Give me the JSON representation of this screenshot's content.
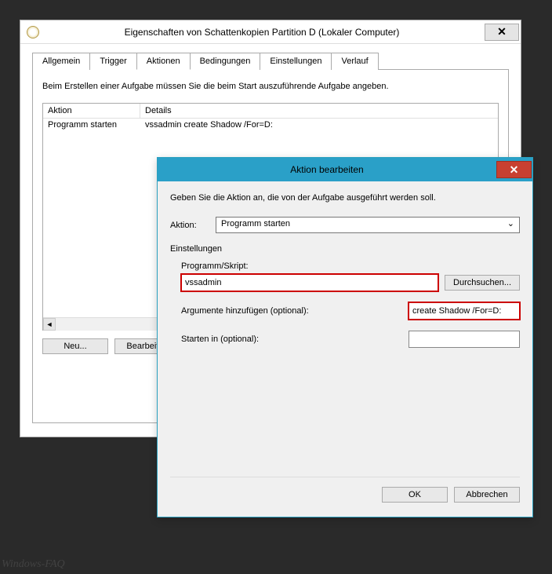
{
  "parent": {
    "title": "Eigenschaften von Schattenkopien Partition D (Lokaler Computer)",
    "close": "✕",
    "tabs": {
      "allgemein": "Allgemein",
      "trigger": "Trigger",
      "aktionen": "Aktionen",
      "bedingungen": "Bedingungen",
      "einstellungen": "Einstellungen",
      "verlauf": "Verlauf"
    },
    "instructions": "Beim Erstellen einer Aufgabe müssen Sie die beim Start auszuführende Aufgabe angeben.",
    "columns": {
      "aktion": "Aktion",
      "details": "Details"
    },
    "row": {
      "aktion": "Programm starten",
      "details": "vssadmin create Shadow /For=D:"
    },
    "buttons": {
      "neu": "Neu...",
      "bearbeiten": "Bearbeiten"
    }
  },
  "child": {
    "title": "Aktion bearbeiten",
    "close": "✕",
    "desc": "Geben Sie die Aktion an, die von der Aufgabe ausgeführt werden soll.",
    "aktion_label": "Aktion:",
    "aktion_value": "Programm starten",
    "settings_label": "Einstellungen",
    "program_label": "Programm/Skript:",
    "program_value": "vssadmin",
    "browse": "Durchsuchen...",
    "args_label": "Argumente hinzufügen (optional):",
    "args_value": "create Shadow /For=D:",
    "startin_label": "Starten in (optional):",
    "startin_value": "",
    "ok": "OK",
    "cancel": "Abbrechen"
  },
  "watermark": "Windows-FAQ"
}
